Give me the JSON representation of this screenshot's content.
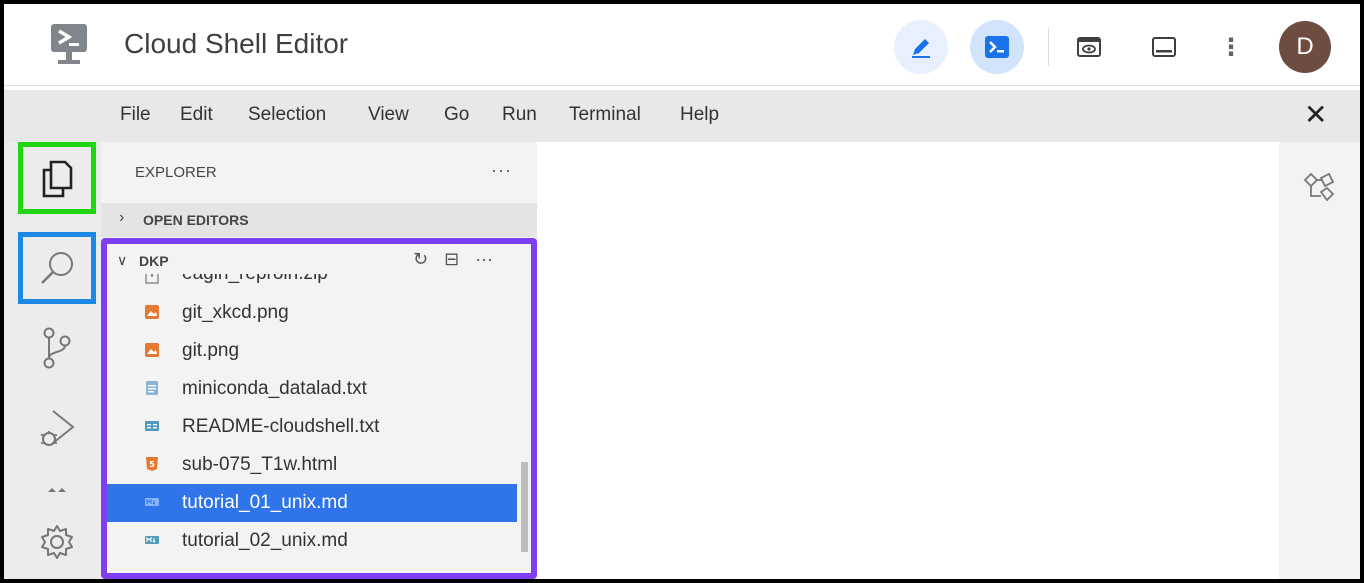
{
  "app": {
    "title": "Cloud Shell Editor"
  },
  "toolbar": {
    "icons": [
      "pencil-icon",
      "terminal-icon",
      "web-preview-icon",
      "panel-icon",
      "more-vert-icon"
    ],
    "more_label": "⋮",
    "avatar_initial": "D",
    "avatar_color": "#6d4c41",
    "active_editor_bg": "#e8f0fe",
    "active_terminal_bg": "#d2e3fc"
  },
  "menu": {
    "items": [
      "File",
      "Edit",
      "Selection",
      "View",
      "Go",
      "Run",
      "Terminal",
      "Help"
    ],
    "close_label": "✕"
  },
  "activity_bar": {
    "items": [
      "explorer-icon",
      "search-icon",
      "source-control-icon",
      "run-debug-icon",
      "settings-icon"
    ],
    "highlight_explorer": "#22d511",
    "highlight_search": "#1e88e5"
  },
  "explorer": {
    "title": "EXPLORER",
    "more_label": "···",
    "open_editors_label": "OPEN EDITORS",
    "folder_label": "DKP",
    "folder_highlight": "#7e3ff2",
    "files": [
      {
        "name": "eagin_reproin.zip",
        "type": "zip"
      },
      {
        "name": "git_xkcd.png",
        "type": "image"
      },
      {
        "name": "git.png",
        "type": "image"
      },
      {
        "name": "miniconda_datalad.txt",
        "type": "text"
      },
      {
        "name": "README-cloudshell.txt",
        "type": "readme"
      },
      {
        "name": "sub-075_T1w.html",
        "type": "html"
      },
      {
        "name": "tutorial_01_unix.md",
        "type": "markdown",
        "selected": true
      },
      {
        "name": "tutorial_02_unix.md",
        "type": "markdown"
      }
    ],
    "selected_color": "#2f74e8"
  }
}
